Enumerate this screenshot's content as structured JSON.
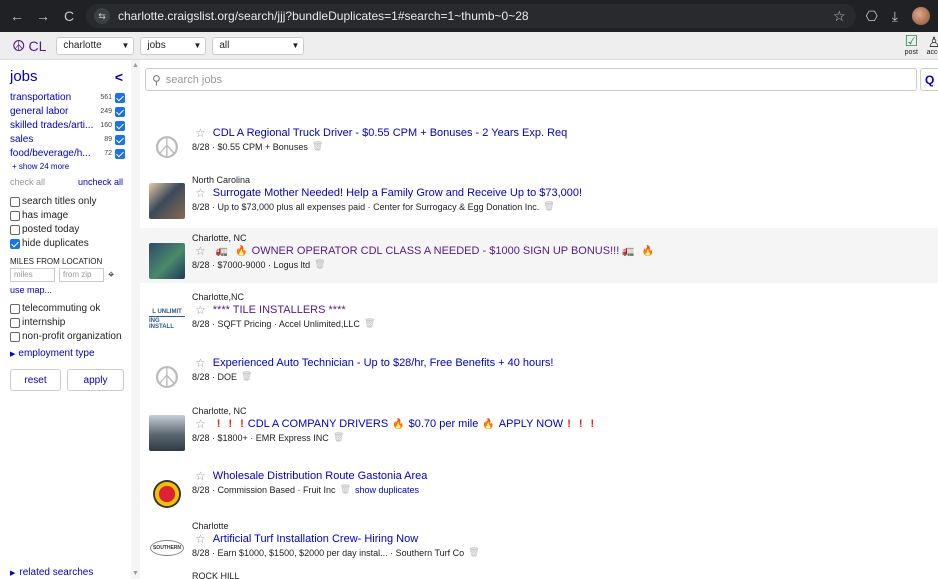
{
  "browser": {
    "url": "charlotte.craigslist.org/search/jjj?bundleDuplicates=1#search=1~thumb~0~28",
    "back_icon": "←",
    "forward_icon": "→",
    "reload_icon": "C",
    "site_icon": "⇆",
    "bookmark_icon": "☆",
    "extensions_icon": "⎔",
    "download_icon": "⤓"
  },
  "header": {
    "logo_icon": "☮",
    "logo_text": "CL",
    "area": "charlotte",
    "category": "jobs",
    "subcategory": "all",
    "post_label": "post",
    "account_label": "acco"
  },
  "sidebar": {
    "title": "jobs",
    "collapse_icon": "<",
    "categories": [
      {
        "name": "transportation",
        "count": "561"
      },
      {
        "name": "general labor",
        "count": "249"
      },
      {
        "name": "skilled trades/arti...",
        "count": "160"
      },
      {
        "name": "sales",
        "count": "89"
      },
      {
        "name": "food/beverage/h...",
        "count": "72"
      }
    ],
    "show_more": "+ show 24 more",
    "check_all": "check all",
    "uncheck_all": "uncheck all",
    "options": [
      {
        "label": "search titles only",
        "checked": false
      },
      {
        "label": "has image",
        "checked": false
      },
      {
        "label": "posted today",
        "checked": false
      },
      {
        "label": "hide duplicates",
        "checked": true
      }
    ],
    "miles_label": "MILES FROM LOCATION",
    "miles_placeholder": "miles",
    "zip_placeholder": "from zip",
    "use_map": "use map...",
    "options2": [
      {
        "label": "telecommuting ok",
        "checked": false
      },
      {
        "label": "internship",
        "checked": false
      },
      {
        "label": "non-profit organization",
        "checked": false
      }
    ],
    "employment_type": "employment type",
    "reset": "reset",
    "apply": "apply",
    "related_searches": "related searches"
  },
  "search": {
    "placeholder": "search jobs",
    "button": "Q"
  },
  "listings": [
    {
      "location": "",
      "title": "CDL A Regional Truck Driver - $0.55 CPM + Bonuses - 2 Years Exp. Req",
      "details": "8/28 · $0.55 CPM + Bonuses"
    },
    {
      "location": "North Carolina",
      "title": "Surrogate Mother Needed! Help a Family Grow and Receive Up to $73,000!",
      "details": "8/28 · Up to $73,000 plus all expenses paid · Center for Surrogacy & Egg Donation Inc."
    },
    {
      "location": "Charlotte, NC",
      "title": "OWNER OPERATOR CDL CLASS A NEEDED - $1000 SIGN UP BONUS!!!",
      "details": "8/28 · $7000-9000 · Logus ltd"
    },
    {
      "location": "Charlotte,NC",
      "title": "**** TILE INSTALLERS ****",
      "details": "8/28 · SQFT Pricing · Accel Unlimited,LLC",
      "thumb_text_1": "L UNLIMIT",
      "thumb_text_2": "ING INSTALL"
    },
    {
      "location": "",
      "title": "Experienced Auto Technician - Up to $28/hr, Free Benefits + 40 hours!",
      "details": "8/28 · DOE"
    },
    {
      "location": "Charlotte, NC",
      "title_a": "CDL A COMPANY DRIVERS",
      "title_b": "$0.70 per mile",
      "title_c": "APPLY NOW",
      "details": "8/28 · $1800+ · EMR Express INC"
    },
    {
      "location": "",
      "title": "Wholesale Distribution Route Gastonia Area",
      "details": "8/28 · Commission Based · Fruit Inc",
      "show_duplicates": "show duplicates"
    },
    {
      "location": "Charlotte",
      "title": "Artificial Turf Installation Crew- Hiring Now",
      "details": "8/28 · Earn $1000, $1500, $2000 per day instal... · Southern Turf Co",
      "thumb_text": "SOUTHERN"
    }
  ],
  "next_location": "ROCK HILL"
}
